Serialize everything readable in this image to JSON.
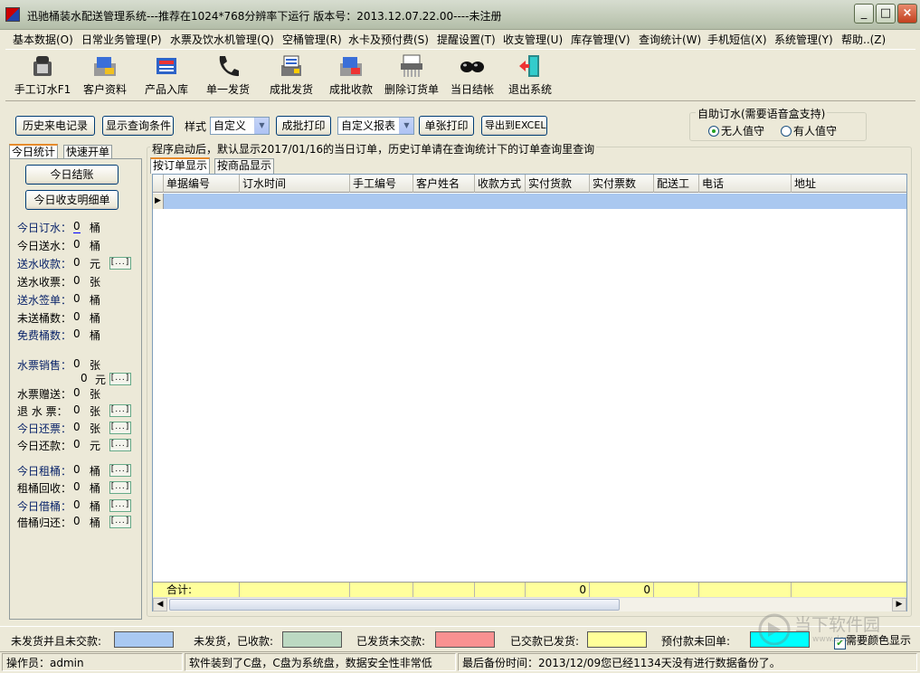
{
  "window": {
    "title": "迅驰桶装水配送管理系统---推荐在1024*768分辨率下运行  版本号：2013.12.07.22.00----未注册",
    "minimize": "_",
    "maximize": "□",
    "close": "×"
  },
  "menu": [
    "基本数据(O)",
    "日常业务管理(P)",
    "水票及饮水机管理(Q)",
    "空桶管理(R)",
    "水卡及预付费(S)",
    "提醒设置(T)",
    "收支管理(U)",
    "库存管理(V)",
    "查询统计(W)",
    "手机短信(X)",
    "系统管理(Y)",
    "帮助..(Z)"
  ],
  "toolbar": [
    {
      "label": "手工订水F1",
      "icon": "phone-icon"
    },
    {
      "label": "客户资料",
      "icon": "customer-icon"
    },
    {
      "label": "产品入库",
      "icon": "product-icon"
    },
    {
      "label": "单一发货",
      "icon": "handset-icon"
    },
    {
      "label": "成批发货",
      "icon": "batch-ship-icon"
    },
    {
      "label": "成批收款",
      "icon": "batch-receive-icon"
    },
    {
      "label": "删除订货单",
      "icon": "shredder-icon"
    },
    {
      "label": "当日结帐",
      "icon": "glasses-icon"
    },
    {
      "label": "退出系统",
      "icon": "exit-icon"
    }
  ],
  "controls": {
    "history_calls": "历史来电记录",
    "show_query": "显示查询条件",
    "style_label": "样式",
    "style_value": "自定义",
    "batch_print": "成批打印",
    "report_value": "自定义报表",
    "single_print": "单张打印",
    "export_excel": "导出到EXCEL"
  },
  "auto_order": {
    "title": "自助订水(需要语音盒支持)",
    "option1": "无人值守",
    "option2": "有人值守",
    "selected": "无人值守"
  },
  "left_tabs": [
    "今日统计",
    "快速开单"
  ],
  "left_buttons": {
    "settle": "今日结账",
    "detail": "今日收支明细单"
  },
  "stats": [
    {
      "label": "今日订水：",
      "value": "0",
      "unit": "桶"
    },
    {
      "label": "今日送水：",
      "value": "0",
      "unit": "桶"
    },
    {
      "label": "送水收款：",
      "value": "0",
      "unit": "元"
    },
    {
      "label": "送水收票：",
      "value": "0",
      "unit": "张"
    },
    {
      "label": "送水签单：",
      "value": "0",
      "unit": "桶"
    },
    {
      "label": "未送桶数：",
      "value": "0",
      "unit": "桶"
    },
    {
      "label": "免费桶数：",
      "value": "0",
      "unit": "桶"
    },
    {
      "label": "水票销售：",
      "value": "0",
      "unit": "张"
    },
    {
      "label": "",
      "value": "0",
      "unit": "元"
    },
    {
      "label": "水票赠送：",
      "value": "0",
      "unit": "张"
    },
    {
      "label": "退 水 票：",
      "value": "0",
      "unit": "张"
    },
    {
      "label": "今日还票：",
      "value": "0",
      "unit": "张"
    },
    {
      "label": "今日还款：",
      "value": "0",
      "unit": "元"
    },
    {
      "label": "今日租桶：",
      "value": "0",
      "unit": "桶"
    },
    {
      "label": "租桶回收：",
      "value": "0",
      "unit": "桶"
    },
    {
      "label": "今日借桶：",
      "value": "0",
      "unit": "桶"
    },
    {
      "label": "借桶归还：",
      "value": "0",
      "unit": "桶"
    }
  ],
  "dots": "[...]",
  "notice": "程序启动后，默认显示2017/01/16的当日订单，历史订单请在查询统计下的订单查询里查询",
  "grid_tabs": [
    "按订单显示",
    "按商品显示"
  ],
  "columns": [
    "单据编号",
    "订水时间",
    "手工编号",
    "客户姓名",
    "收款方式",
    "实付货款",
    "实付票数",
    "配送工",
    "电话",
    "地址"
  ],
  "totals": {
    "label": "合计:",
    "goods": "0",
    "tickets": "0"
  },
  "legend": [
    {
      "label": "未发货并且未交款:",
      "color": "#a9c9f2"
    },
    {
      "label": "未发货，已收款:",
      "color": "#bcd9c2"
    },
    {
      "label": "已发货未交款:",
      "color": "#f99191"
    },
    {
      "label": "已交款已发货:",
      "color": "#ffff99"
    },
    {
      "label": "预付款未回单:",
      "color": "#00ffff"
    }
  ],
  "need_color": "需要颜色显示",
  "status": {
    "operator": "操作员：admin",
    "install": "软件装到了C盘，C盘为系统盘，数据安全性非常低",
    "backup": "最后备份时间：2013/12/09您已经1134天没有进行数据备份了。"
  },
  "watermark": {
    "text1": "当下软件园",
    "text2": "www.downxia.com"
  }
}
